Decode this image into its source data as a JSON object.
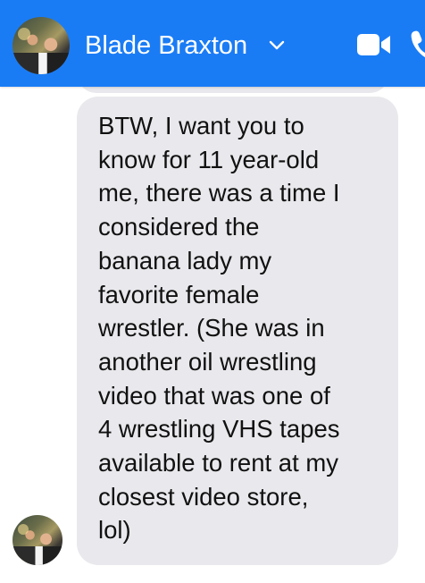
{
  "header": {
    "contact_name": "Blade Braxton",
    "icons": {
      "dropdown": "chevron-down-icon",
      "video_call": "video-camera-icon",
      "voice_call": "phone-icon"
    },
    "colors": {
      "bar": "#1a7cf5",
      "foreground": "#ffffff"
    }
  },
  "conversation": {
    "message": {
      "text": "BTW, I want you to\nknow for 11 year-old\nme, there was a time I\nconsidered the\nbanana lady my\nfavorite female\nwrestler. (She was in\nanother oil wrestling\nvideo that was one of\n4 wrestling VHS tapes\navailable to rent at my\nclosest video store,\nlol)",
      "bubble_color": "#e9e9ed",
      "text_color": "#111111"
    }
  }
}
